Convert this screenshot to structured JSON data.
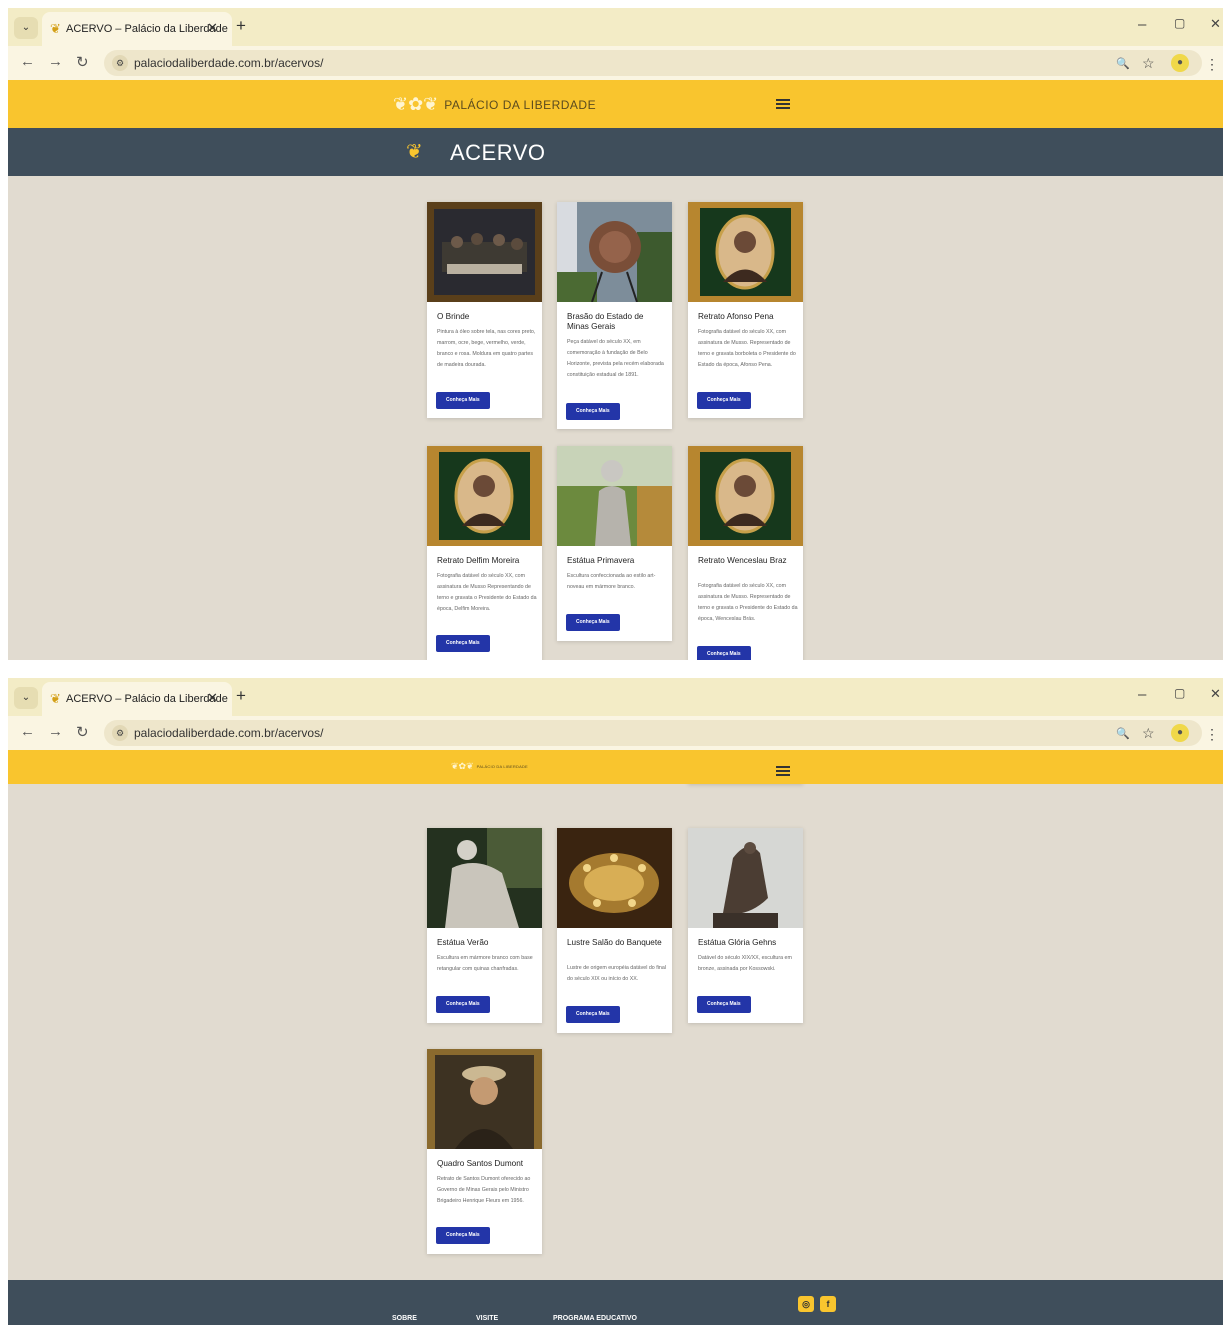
{
  "browser": {
    "tab_title": "ACERVO – Palácio da Liberdade",
    "tab_close": "✕",
    "new_tab": "+",
    "url": "palaciodaliberdade.com.br/acervos/",
    "icons": {
      "back": "←",
      "forward": "→",
      "reload": "↻",
      "zoom": "🔍",
      "star": "☆",
      "kebab": "⋮",
      "minimize": "–",
      "restore": "▢",
      "close": "✕",
      "dropdown": "⌄"
    }
  },
  "site": {
    "logo_text": "PALÁCIO DA LIBERDADE",
    "page_title": "ACERVO",
    "button_label": "Conheça Mais"
  },
  "cards": [
    {
      "title": "O Brinde",
      "desc": "Pintura à óleo sobre tela, nas cores preto, marrom, ocre, bege, vermelho, verde, branco e rosa. Moldura em quatro partes de madeira dourada."
    },
    {
      "title": "Brasão do Estado de Minas Gerais",
      "desc": "Peça datável do século XX, em comemoração à fundação de Belo Horizonte, prevista pela recém elaborada constituição estadual de 1891."
    },
    {
      "title": "Retrato Afonso Pena",
      "desc": "Fotografia datável do século XX, com assinatura de Musso. Representado de terno e gravata borboleta o Presidente do Estado da época, Afonso Pena."
    },
    {
      "title": "Retrato Delfim Moreira",
      "desc": "Fotografia datável do século XX, com assinatura de Musso Representando de terno e gravata o Presidente do Estado da época, Delfim Moreira."
    },
    {
      "title": "Estátua Primavera",
      "desc": "Escultura confeccionada ao estilo art-noveau em mármore branco."
    },
    {
      "title": "Retrato Wenceslau Braz",
      "desc": "Fotografia datável do século XX, com assinatura de Musso. Representado de terno e gravata o Presidente do Estado da época, Wenceslau Brás."
    },
    {
      "title": "Estátua Verão",
      "desc": "Escultura em mármore branco com base retangular com quinas chanfradas."
    },
    {
      "title": "Lustre Salão do Banquete",
      "desc": "Lustre de origem européia datável do final do século XIX ou início do XX."
    },
    {
      "title": "Estátua Glória Gehns",
      "desc": "Datável do século XIX/XX, escultura em bronze, assinada por Kossowski."
    },
    {
      "title": "Quadro Santos Dumont",
      "desc": "Retrato de Santos Dumont oferecido ao Governo de Minas Gerais pelo Ministro Brigadeiro Henrique Fleurs em 1956."
    }
  ],
  "footer": {
    "links": [
      "SOBRE",
      "VISITE",
      "PROGRAMA EDUCATIVO"
    ],
    "social": [
      "instagram",
      "facebook"
    ]
  }
}
